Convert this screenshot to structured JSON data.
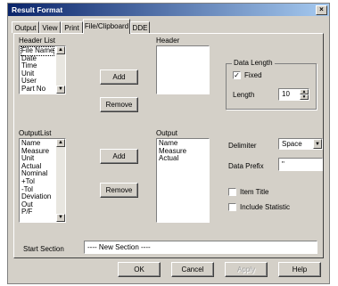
{
  "window": {
    "title": "Result Format",
    "close_glyph": "×"
  },
  "tabs": [
    {
      "label": "Output"
    },
    {
      "label": "View"
    },
    {
      "label": "Print"
    },
    {
      "label": "File/Clipboard"
    },
    {
      "label": "DDE"
    }
  ],
  "header_list": {
    "label": "Header List",
    "items": [
      "File Name",
      "Date",
      "Time",
      "Unit",
      "User",
      "Part No"
    ]
  },
  "header": {
    "label": "Header",
    "items": []
  },
  "buttons": {
    "add": "Add",
    "remove": "Remove",
    "add2": "Add",
    "remove2": "Remove",
    "ok": "OK",
    "cancel": "Cancel",
    "apply": "Apply",
    "help": "Help"
  },
  "data_length": {
    "group_label": "Data Length",
    "fixed_label": "Fixed",
    "fixed_checked": true,
    "length_label": "Length",
    "length_value": "10"
  },
  "output_list": {
    "label": "OutputList",
    "items": [
      "Name",
      "Measure",
      "Unit",
      "Actual",
      "Nominal",
      "+Tol",
      "-Tol",
      "Deviation",
      "Out",
      "P/F"
    ]
  },
  "output": {
    "label": "Output",
    "items": [
      "Name",
      "Measure",
      "Actual"
    ]
  },
  "delimiter": {
    "label": "Delimiter",
    "value": "Space"
  },
  "data_prefix": {
    "label": "Data Prefix",
    "value": "\""
  },
  "item_title": {
    "label": "Item Title",
    "checked": false
  },
  "include_statistic": {
    "label": "Include Statistic",
    "checked": false
  },
  "start_section": {
    "label": "Start Section",
    "value": "---- New Section ----"
  },
  "icons": {
    "close": "close-icon",
    "scroll_up": "scroll-up-arrow-icon",
    "scroll_down": "scroll-down-arrow-icon",
    "dropdown": "chevron-down-icon",
    "spin_up": "spin-up-icon",
    "spin_down": "spin-down-icon",
    "check": "checkmark-icon"
  },
  "colors": {
    "title_start": "#0a246a",
    "title_end": "#a6caf0",
    "face": "#d4d0c8"
  }
}
